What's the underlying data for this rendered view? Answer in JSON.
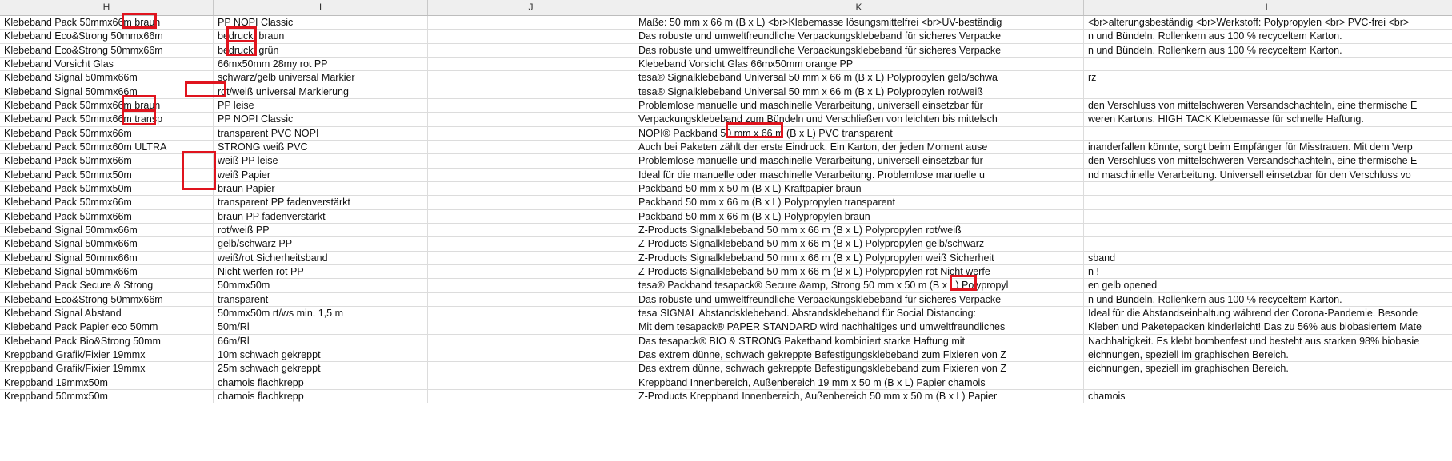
{
  "columns": [
    "H",
    "I",
    "J",
    "K",
    "L"
  ],
  "rows": [
    [
      "Klebeband Pack 50mmx66m braun",
      "PP NOPI Classic",
      "",
      "Maße: 50 mm x 66 m (B x L) <br>Klebemasse lösungsmittelfrei <br>UV-beständig",
      "<br>alterungsbeständig <br>Werkstoff: Polypropylen <br> PVC-frei <br>"
    ],
    [
      "Klebeband Eco&Strong 50mmx66m",
      "bedruckt braun",
      "",
      "Das robuste und umweltfreundliche Verpackungsklebeband für sicheres Verpacke",
      "n und Bündeln. Rollenkern aus 100 % recyceltem Karton."
    ],
    [
      "Klebeband Eco&Strong 50mmx66m",
      "bedruckt grün",
      "",
      "Das robuste und umweltfreundliche Verpackungsklebeband für sicheres Verpacke",
      "n und Bündeln. Rollenkern aus 100 % recyceltem Karton."
    ],
    [
      "Klebeband Vorsicht Glas",
      "66mx50mm 28my rot PP",
      "",
      "Klebeband Vorsicht Glas 66mx50mm orange PP",
      ""
    ],
    [
      "Klebeband Signal 50mmx66m",
      "schwarz/gelb universal Markier",
      "",
      "tesa® Signalklebeband Universal 50 mm x 66 m (B x L) Polypropylen gelb/schwa",
      "rz"
    ],
    [
      "Klebeband Signal 50mmx66m",
      "rot/weiß universal Markierung",
      "",
      "tesa® Signalklebeband Universal 50 mm x 66 m (B x L) Polypropylen rot/weiß",
      ""
    ],
    [
      "Klebeband Pack 50mmx66m braun",
      "PP leise",
      "",
      "Problemlose manuelle und maschinelle Verarbeitung, universell einsetzbar für",
      "den Verschluss von mittelschweren Versandschachteln, eine thermische E"
    ],
    [
      "Klebeband Pack 50mmx66m transp",
      "PP NOPI Classic",
      "",
      "Verpackungsklebeband zum Bündeln und Verschließen von leichten bis mittelsch",
      "weren Kartons. HIGH TACK Klebemasse für schnelle Haftung."
    ],
    [
      "Klebeband Pack 50mmx66m",
      "transparent PVC NOPI",
      "",
      "NOPI® Packband 50 mm x 66 m (B x L) PVC transparent",
      ""
    ],
    [
      "Klebeband Pack 50mmx60m ULTRA",
      "STRONG weiß PVC",
      "",
      "Auch bei Paketen zählt der erste Eindruck. Ein Karton, der jeden Moment ause",
      "inanderfallen könnte, sorgt beim Empfänger für Misstrauen. Mit dem Verp"
    ],
    [
      "Klebeband Pack 50mmx66m",
      "weiß PP leise",
      "",
      "Problemlose manuelle und maschinelle Verarbeitung, universell einsetzbar für",
      "den Verschluss von mittelschweren Versandschachteln, eine thermische E"
    ],
    [
      "Klebeband Pack 50mmx50m",
      "weiß Papier",
      "",
      "Ideal für die manuelle oder maschinelle Verarbeitung. Problemlose manuelle u",
      "nd maschinelle Verarbeitung. Universell einsetzbar für den Verschluss vo"
    ],
    [
      "Klebeband Pack 50mmx50m",
      "braun Papier",
      "",
      "Packband 50 mm x 50 m (B x L) Kraftpapier braun",
      ""
    ],
    [
      "Klebeband Pack 50mmx66m",
      "transparent PP fadenverstärkt",
      "",
      "Packband 50 mm x 66 m (B x L) Polypropylen transparent",
      ""
    ],
    [
      "Klebeband Pack 50mmx66m",
      "braun PP fadenverstärkt",
      "",
      "Packband 50 mm x 66 m (B x L) Polypropylen braun",
      ""
    ],
    [
      "Klebeband Signal 50mmx66m",
      "rot/weiß PP",
      "",
      "Z-Products Signalklebeband 50 mm x 66 m (B x L) Polypropylen rot/weiß",
      ""
    ],
    [
      "Klebeband Signal 50mmx66m",
      "gelb/schwarz PP",
      "",
      "Z-Products Signalklebeband 50 mm x 66 m (B x L) Polypropylen gelb/schwarz",
      ""
    ],
    [
      "Klebeband Signal 50mmx66m",
      "weiß/rot Sicherheitsband",
      "",
      "Z-Products Signalklebeband 50 mm x 66 m (B x L) Polypropylen weiß Sicherheit",
      "sband"
    ],
    [
      "Klebeband Signal 50mmx66m",
      "Nicht werfen rot PP",
      "",
      "Z-Products Signalklebeband 50 mm x 66 m (B x L) Polypropylen rot Nicht werfe",
      "n !"
    ],
    [
      "Klebeband Pack Secure & Strong",
      "50mmx50m",
      "",
      "tesa® Packband tesapack® Secure &amp, Strong 50 mm x 50 m (B x L) Polypropyl",
      "en gelb opened"
    ],
    [
      "Klebeband Eco&Strong 50mmx66m",
      "transparent",
      "",
      "Das robuste und umweltfreundliche Verpackungsklebeband für sicheres Verpacke",
      "n und Bündeln. Rollenkern aus 100 % recyceltem Karton."
    ],
    [
      "Klebeband Signal Abstand",
      "50mmx50m rt/ws min. 1,5 m",
      "",
      " tesa SIGNAL Abstandsklebeband. Abstandsklebeband für Social Distancing:",
      "Ideal für die Abstandseinhaltung während der Corona-Pandemie. Besonde"
    ],
    [
      "Klebeband Pack Papier eco 50mm",
      "50m/Rl",
      "",
      "Mit dem tesapack® PAPER STANDARD wird nachhaltiges und umweltfreundliches",
      "Kleben und Paketepacken kinderleicht! Das zu 56% aus biobasiertem Mate"
    ],
    [
      "Klebeband Pack Bio&Strong 50mm",
      "66m/Rl",
      "",
      "Das tesapack® BIO & STRONG Paketband kombiniert starke Haftung mit",
      "Nachhaltigkeit. Es klebt bombenfest und besteht aus starken 98% biobasie"
    ],
    [
      "Kreppband Grafik/Fixier 19mmx",
      "10m schwach gekreppt",
      "",
      "Das extrem dünne, schwach gekreppte Befestigungsklebeband zum Fixieren von Z",
      "eichnungen, speziell im graphischen Bereich."
    ],
    [
      "Kreppband Grafik/Fixier 19mmx",
      "25m schwach gekreppt",
      "",
      "Das extrem dünne, schwach gekreppte Befestigungsklebeband zum Fixieren von Z",
      "eichnungen, speziell im graphischen Bereich."
    ],
    [
      "Kreppband 19mmx50m",
      "chamois flachkrepp",
      "",
      "Kreppband Innenbereich, Außenbereich 19 mm x 50 m (B x L) Papier chamois",
      ""
    ],
    [
      "Kreppband 50mmx50m",
      "chamois flachkrepp",
      "",
      "Z-Products Kreppband Innenbereich, Außenbereich 50 mm x 50 m (B x L) Papier",
      "chamois"
    ]
  ],
  "highlight_color": "#e0141e"
}
